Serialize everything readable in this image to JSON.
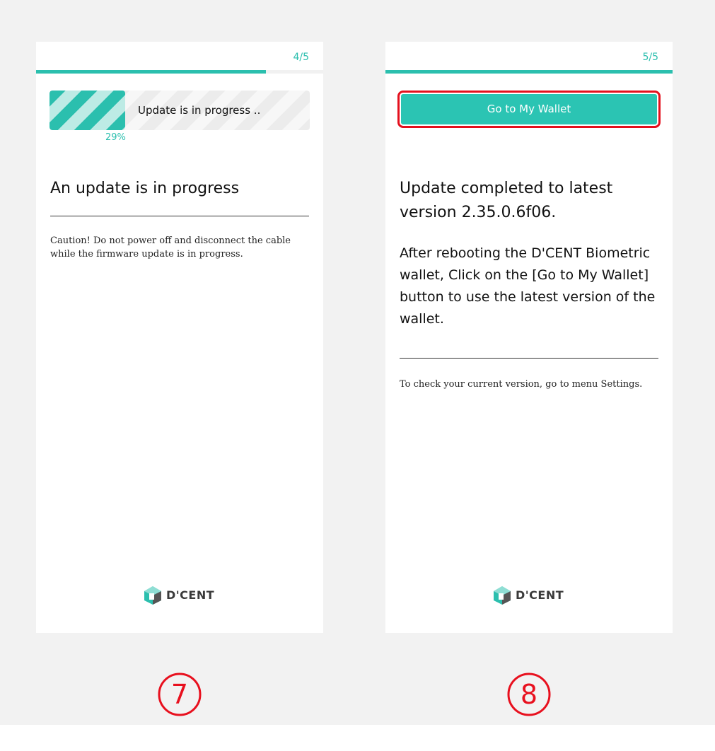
{
  "colors": {
    "accent": "#2bbfae",
    "highlight": "#e4101d",
    "marker": "#e8101e"
  },
  "screen_update": {
    "step": "4/5",
    "step_progress": 0.8,
    "progress_label": "Update is in progress ..",
    "progress_value": 0.29,
    "progress_percent": "29%",
    "title": "An update is in progress",
    "caution": "Caution! Do not power off and disconnect the cable while the firmware update is in progress.",
    "logo_icon": "dcent-logo-icon",
    "logo_text": "D'CENT"
  },
  "screen_complete": {
    "step": "5/5",
    "step_progress": 1.0,
    "wallet_button": "Go to My Wallet",
    "title": "Update completed to latest version 2.35.0.6f06.",
    "instruction": "After rebooting the D'CENT Biometric wallet, Click on the [Go to My Wallet] button to use the latest version of the wallet.",
    "note": "To check your current version, go to menu Settings.",
    "logo_icon": "dcent-logo-icon",
    "logo_text": "D'CENT"
  },
  "step_markers": [
    "7",
    "8"
  ]
}
